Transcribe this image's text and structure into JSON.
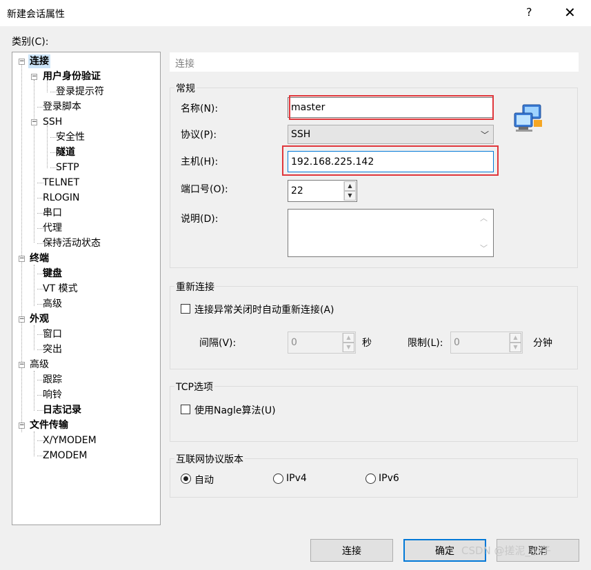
{
  "window": {
    "title": "新建会话属性",
    "help": "?",
    "close": "✕"
  },
  "category_label": "类别(C):",
  "tree": [
    {
      "label": "连接",
      "bold": true,
      "selected": true,
      "toggle": "−"
    },
    {
      "label": "用户身份验证",
      "bold": true,
      "toggle": "−"
    },
    {
      "label": "登录提示符"
    },
    {
      "label": "登录脚本"
    },
    {
      "label": "SSH",
      "toggle": "−"
    },
    {
      "label": "安全性"
    },
    {
      "label": "隧道",
      "bold": true
    },
    {
      "label": "SFTP"
    },
    {
      "label": "TELNET"
    },
    {
      "label": "RLOGIN"
    },
    {
      "label": "串口"
    },
    {
      "label": "代理"
    },
    {
      "label": "保持活动状态"
    },
    {
      "label": "终端",
      "bold": true,
      "toggle": "−"
    },
    {
      "label": "键盘",
      "bold": true
    },
    {
      "label": "VT 模式"
    },
    {
      "label": "高级"
    },
    {
      "label": "外观",
      "bold": true,
      "toggle": "−"
    },
    {
      "label": "窗口"
    },
    {
      "label": "突出"
    },
    {
      "label": "高级",
      "toggle": "−"
    },
    {
      "label": "跟踪"
    },
    {
      "label": "响铃"
    },
    {
      "label": "日志记录",
      "bold": true
    },
    {
      "label": "文件传输",
      "bold": true,
      "toggle": "−"
    },
    {
      "label": "X/YMODEM"
    },
    {
      "label": "ZMODEM"
    }
  ],
  "panel_header": "连接",
  "general": {
    "title": "常规",
    "name_label": "名称(N):",
    "name_value": "master",
    "protocol_label": "协议(P):",
    "protocol_value": "SSH",
    "host_label": "主机(H):",
    "host_value": "192.168.225.142",
    "port_label": "端口号(O):",
    "port_value": "22",
    "desc_label": "说明(D):",
    "desc_value": ""
  },
  "reconnect": {
    "title": "重新连接",
    "checkbox_label": "连接异常关闭时自动重新连接(A)",
    "interval_label": "间隔(V):",
    "interval_value": "0",
    "interval_unit": "秒",
    "limit_label": "限制(L):",
    "limit_value": "0",
    "limit_unit": "分钟"
  },
  "tcp": {
    "title": "TCP选项",
    "nagle_label": "使用Nagle算法(U)"
  },
  "ip_version": {
    "title": "互联网协议版本",
    "options": [
      "自动",
      "IPv4",
      "IPv6"
    ],
    "selected": "自动"
  },
  "buttons": {
    "connect": "连接",
    "ok": "确定",
    "cancel": "取消"
  },
  "watermark": "CSDN @搓泥_小子",
  "colors": {
    "highlight": "#e0363b",
    "selection": "#cce4f7",
    "default_border": "#0078d7"
  }
}
